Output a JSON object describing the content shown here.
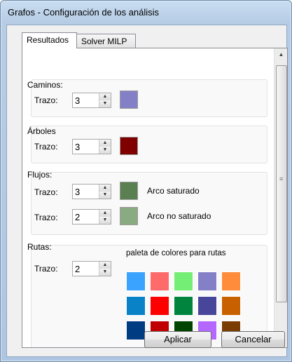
{
  "window": {
    "title": "Grafos - Configuración de los análisis"
  },
  "tabs": [
    {
      "label": "Resultados",
      "active": true
    },
    {
      "label": "Solver MILP",
      "active": false
    }
  ],
  "caminos": {
    "title": "Caminos:",
    "trazo_label": "Trazo:",
    "trazo_value": "3",
    "color": "#8480c8"
  },
  "arboles": {
    "title": "Árboles",
    "trazo_label": "Trazo:",
    "trazo_value": "3",
    "color": "#800000"
  },
  "flujos": {
    "title": "Flujos:",
    "saturado": {
      "trazo_label": "Trazo:",
      "trazo_value": "3",
      "color": "#5a7f50",
      "label": "Arco saturado"
    },
    "no_saturado": {
      "trazo_label": "Trazo:",
      "trazo_value": "2",
      "color": "#8aaa82",
      "label": "Arco no saturado"
    }
  },
  "rutas": {
    "title": "Rutas:",
    "trazo_label": "Trazo:",
    "trazo_value": "2",
    "palette_label": "paleta de colores para rutas",
    "palette_colors": [
      [
        "#3aa2ff",
        "#ff6a6a",
        "#74ee74",
        "#8480c8",
        "#ff8c3a"
      ],
      [
        "#0a82c8",
        "#ff0000",
        "#00843e",
        "#48469a",
        "#c86000"
      ],
      [
        "#003c82",
        "#c00000",
        "#004400",
        "#b468ff",
        "#7a3c00"
      ]
    ]
  },
  "buttons": {
    "apply": "Aplicar",
    "cancel": "Cancelar"
  }
}
